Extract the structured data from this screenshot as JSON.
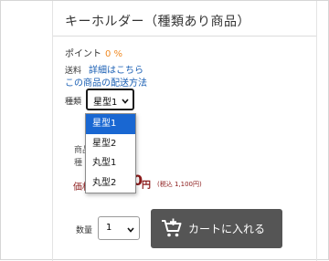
{
  "product": {
    "title": "キーホルダー（種類あり商品）"
  },
  "points": {
    "label": "ポイント",
    "value": "0 %"
  },
  "shipping": {
    "label": "送料",
    "details_link": "詳細はこちら",
    "method_link": "この商品の配送方法"
  },
  "variant": {
    "label": "種類",
    "selected": "星型1",
    "options": [
      "星型1",
      "星型2",
      "丸型1",
      "丸型2"
    ]
  },
  "obscured": {
    "line1": "商品",
    "line2": "種"
  },
  "price": {
    "label": "価格",
    "value": "0",
    "yen": "円",
    "tax_note": "(税込 1,100円)"
  },
  "quantity": {
    "label": "数量",
    "selected": "1"
  },
  "cart": {
    "button_label": "カートに入れる",
    "icon": "cart-plus-icon"
  },
  "colors": {
    "point_accent": "#f08a24",
    "link": "#1a5fb4",
    "price": "#8b1a1a",
    "cart_button": "#555555",
    "dropdown_highlight": "#1967d2"
  }
}
